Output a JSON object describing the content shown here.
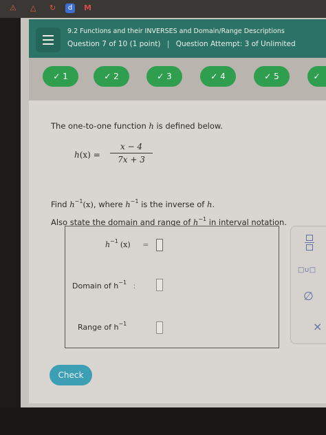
{
  "browser": {
    "tabs": [
      {
        "icon": "alert-icon",
        "glyph": "⚠"
      },
      {
        "icon": "drive-icon",
        "glyph": "△"
      },
      {
        "icon": "refresh-icon",
        "glyph": "↻"
      },
      {
        "icon": "d-icon",
        "glyph": "d"
      },
      {
        "icon": "mail-icon",
        "glyph": "M"
      }
    ]
  },
  "header": {
    "title": "9.2 Functions and their INVERSES and Domain/Range Descriptions",
    "question": "Question 7 of 10 (1 point)",
    "separator": "|",
    "attempt": "Question Attempt: 3 of Unlimited"
  },
  "nav": {
    "questions": [
      {
        "check": "✓",
        "number": "1"
      },
      {
        "check": "✓",
        "number": "2"
      },
      {
        "check": "✓",
        "number": "3"
      },
      {
        "check": "✓",
        "number": "4"
      },
      {
        "check": "✓",
        "number": "5"
      },
      {
        "check": "✓",
        "number": ""
      }
    ]
  },
  "problem": {
    "intro_pre": "The one-to-one function ",
    "intro_var": "h",
    "intro_post": " is defined below.",
    "lhs_fn": "h",
    "lhs_arg": "(x)",
    "equals": "=",
    "numerator": "x − 4",
    "denominator": "7x + 3",
    "find_pre": "Find ",
    "find_fn": "h",
    "find_sup": "−1",
    "find_arg": "(x)",
    "find_mid": ", where ",
    "find_fn2": "h",
    "find_sup2": "−1",
    "find_post": " is the inverse of ",
    "find_var": "h",
    "find_end": ".",
    "also_pre": "Also state the domain and range of ",
    "also_fn": "h",
    "also_sup": "−1",
    "also_post": " in interval notation."
  },
  "answer": {
    "inverse_fn": "h",
    "inverse_sup": "−1",
    "inverse_arg": "(x)",
    "inverse_eq": "=",
    "domain_label": "Domain of h",
    "domain_sup": "−1",
    "domain_colon": ":",
    "range_label": "Range of h",
    "range_sup": "−1"
  },
  "tools": {
    "fraction": "fraction-icon",
    "union": "union-icon",
    "union_glyph": "□∪□",
    "empty_set": "empty-set-icon",
    "empty_glyph": "∅",
    "clear": "close-icon",
    "clear_glyph": "×"
  },
  "actions": {
    "check": "Check"
  },
  "colors": {
    "header": "#2b7367",
    "complete": "#2f9e4e",
    "check_button": "#3d9fb3"
  }
}
